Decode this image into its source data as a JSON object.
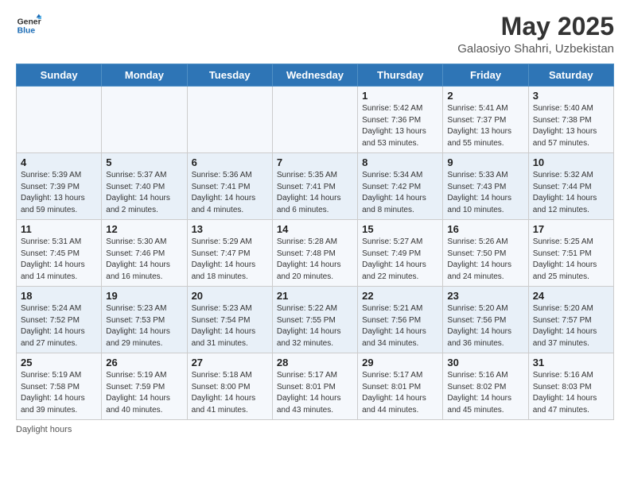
{
  "logo": {
    "line1": "General",
    "line2": "Blue"
  },
  "title": "May 2025",
  "subtitle": "Galaosiyo Shahri, Uzbekistan",
  "header_days": [
    "Sunday",
    "Monday",
    "Tuesday",
    "Wednesday",
    "Thursday",
    "Friday",
    "Saturday"
  ],
  "weeks": [
    [
      {
        "day": "",
        "info": ""
      },
      {
        "day": "",
        "info": ""
      },
      {
        "day": "",
        "info": ""
      },
      {
        "day": "",
        "info": ""
      },
      {
        "day": "1",
        "info": "Sunrise: 5:42 AM\nSunset: 7:36 PM\nDaylight: 13 hours\nand 53 minutes."
      },
      {
        "day": "2",
        "info": "Sunrise: 5:41 AM\nSunset: 7:37 PM\nDaylight: 13 hours\nand 55 minutes."
      },
      {
        "day": "3",
        "info": "Sunrise: 5:40 AM\nSunset: 7:38 PM\nDaylight: 13 hours\nand 57 minutes."
      }
    ],
    [
      {
        "day": "4",
        "info": "Sunrise: 5:39 AM\nSunset: 7:39 PM\nDaylight: 13 hours\nand 59 minutes."
      },
      {
        "day": "5",
        "info": "Sunrise: 5:37 AM\nSunset: 7:40 PM\nDaylight: 14 hours\nand 2 minutes."
      },
      {
        "day": "6",
        "info": "Sunrise: 5:36 AM\nSunset: 7:41 PM\nDaylight: 14 hours\nand 4 minutes."
      },
      {
        "day": "7",
        "info": "Sunrise: 5:35 AM\nSunset: 7:41 PM\nDaylight: 14 hours\nand 6 minutes."
      },
      {
        "day": "8",
        "info": "Sunrise: 5:34 AM\nSunset: 7:42 PM\nDaylight: 14 hours\nand 8 minutes."
      },
      {
        "day": "9",
        "info": "Sunrise: 5:33 AM\nSunset: 7:43 PM\nDaylight: 14 hours\nand 10 minutes."
      },
      {
        "day": "10",
        "info": "Sunrise: 5:32 AM\nSunset: 7:44 PM\nDaylight: 14 hours\nand 12 minutes."
      }
    ],
    [
      {
        "day": "11",
        "info": "Sunrise: 5:31 AM\nSunset: 7:45 PM\nDaylight: 14 hours\nand 14 minutes."
      },
      {
        "day": "12",
        "info": "Sunrise: 5:30 AM\nSunset: 7:46 PM\nDaylight: 14 hours\nand 16 minutes."
      },
      {
        "day": "13",
        "info": "Sunrise: 5:29 AM\nSunset: 7:47 PM\nDaylight: 14 hours\nand 18 minutes."
      },
      {
        "day": "14",
        "info": "Sunrise: 5:28 AM\nSunset: 7:48 PM\nDaylight: 14 hours\nand 20 minutes."
      },
      {
        "day": "15",
        "info": "Sunrise: 5:27 AM\nSunset: 7:49 PM\nDaylight: 14 hours\nand 22 minutes."
      },
      {
        "day": "16",
        "info": "Sunrise: 5:26 AM\nSunset: 7:50 PM\nDaylight: 14 hours\nand 24 minutes."
      },
      {
        "day": "17",
        "info": "Sunrise: 5:25 AM\nSunset: 7:51 PM\nDaylight: 14 hours\nand 25 minutes."
      }
    ],
    [
      {
        "day": "18",
        "info": "Sunrise: 5:24 AM\nSunset: 7:52 PM\nDaylight: 14 hours\nand 27 minutes."
      },
      {
        "day": "19",
        "info": "Sunrise: 5:23 AM\nSunset: 7:53 PM\nDaylight: 14 hours\nand 29 minutes."
      },
      {
        "day": "20",
        "info": "Sunrise: 5:23 AM\nSunset: 7:54 PM\nDaylight: 14 hours\nand 31 minutes."
      },
      {
        "day": "21",
        "info": "Sunrise: 5:22 AM\nSunset: 7:55 PM\nDaylight: 14 hours\nand 32 minutes."
      },
      {
        "day": "22",
        "info": "Sunrise: 5:21 AM\nSunset: 7:56 PM\nDaylight: 14 hours\nand 34 minutes."
      },
      {
        "day": "23",
        "info": "Sunrise: 5:20 AM\nSunset: 7:56 PM\nDaylight: 14 hours\nand 36 minutes."
      },
      {
        "day": "24",
        "info": "Sunrise: 5:20 AM\nSunset: 7:57 PM\nDaylight: 14 hours\nand 37 minutes."
      }
    ],
    [
      {
        "day": "25",
        "info": "Sunrise: 5:19 AM\nSunset: 7:58 PM\nDaylight: 14 hours\nand 39 minutes."
      },
      {
        "day": "26",
        "info": "Sunrise: 5:19 AM\nSunset: 7:59 PM\nDaylight: 14 hours\nand 40 minutes."
      },
      {
        "day": "27",
        "info": "Sunrise: 5:18 AM\nSunset: 8:00 PM\nDaylight: 14 hours\nand 41 minutes."
      },
      {
        "day": "28",
        "info": "Sunrise: 5:17 AM\nSunset: 8:01 PM\nDaylight: 14 hours\nand 43 minutes."
      },
      {
        "day": "29",
        "info": "Sunrise: 5:17 AM\nSunset: 8:01 PM\nDaylight: 14 hours\nand 44 minutes."
      },
      {
        "day": "30",
        "info": "Sunrise: 5:16 AM\nSunset: 8:02 PM\nDaylight: 14 hours\nand 45 minutes."
      },
      {
        "day": "31",
        "info": "Sunrise: 5:16 AM\nSunset: 8:03 PM\nDaylight: 14 hours\nand 47 minutes."
      }
    ]
  ],
  "footer": {
    "daylight_label": "Daylight hours"
  }
}
